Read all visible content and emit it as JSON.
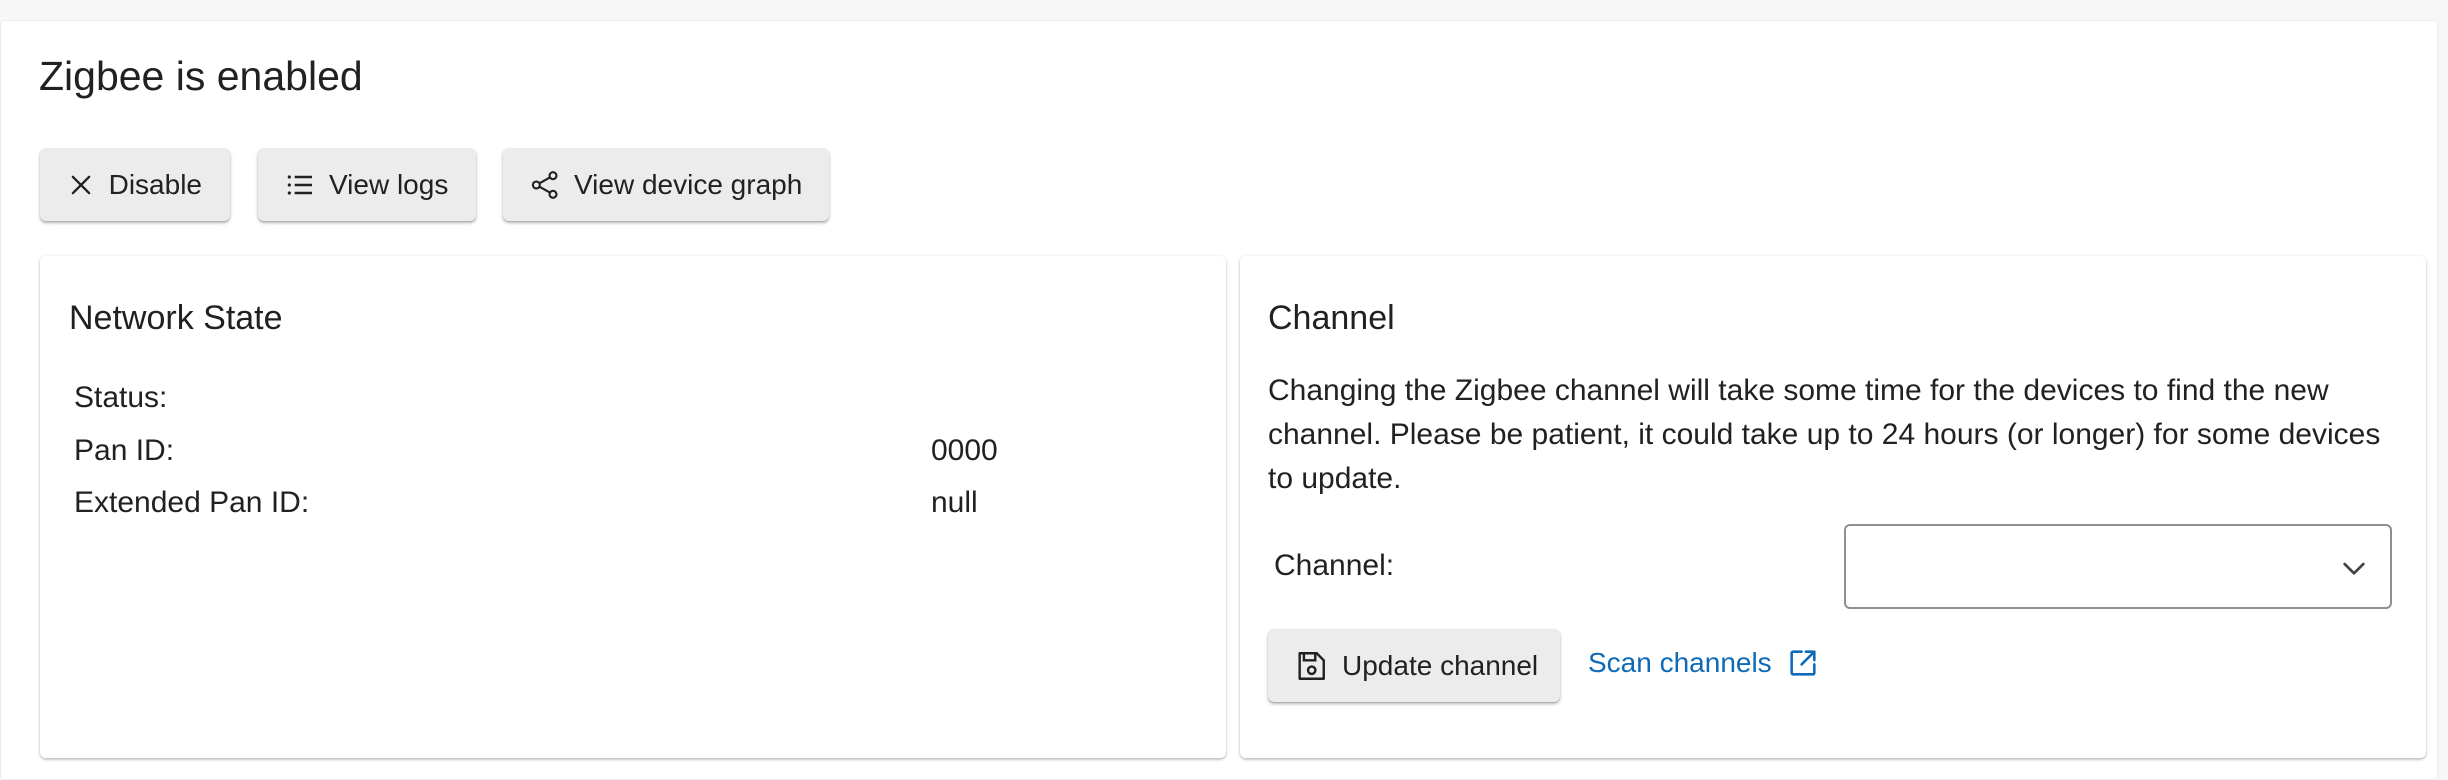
{
  "page": {
    "title": "Zigbee is enabled"
  },
  "actions": {
    "disable_label": "Disable",
    "view_logs_label": "View logs",
    "view_graph_label": "View device graph"
  },
  "network_state": {
    "title": "Network State",
    "rows": [
      {
        "label": "Status:",
        "value": ""
      },
      {
        "label": "Pan ID:",
        "value": "0000"
      },
      {
        "label": "Extended Pan ID:",
        "value": "null"
      }
    ]
  },
  "channel": {
    "title": "Channel",
    "description": "Changing the Zigbee channel will take some time for the devices to find the new channel. Please be patient, it could take up to 24 hours (or longer) for some devices to update.",
    "field_label": "Channel:",
    "selected_value": "",
    "update_label": "Update channel",
    "scan_label": "Scan channels"
  },
  "icons": {
    "disable": "close-icon",
    "logs": "list-icon",
    "graph": "share-icon",
    "select": "chevron-down-icon",
    "update": "floppy-disk-icon",
    "scan": "open-in-new-icon"
  },
  "colors": {
    "link": "#0d6ab8",
    "button_bg": "#ececec",
    "text": "#212121"
  }
}
